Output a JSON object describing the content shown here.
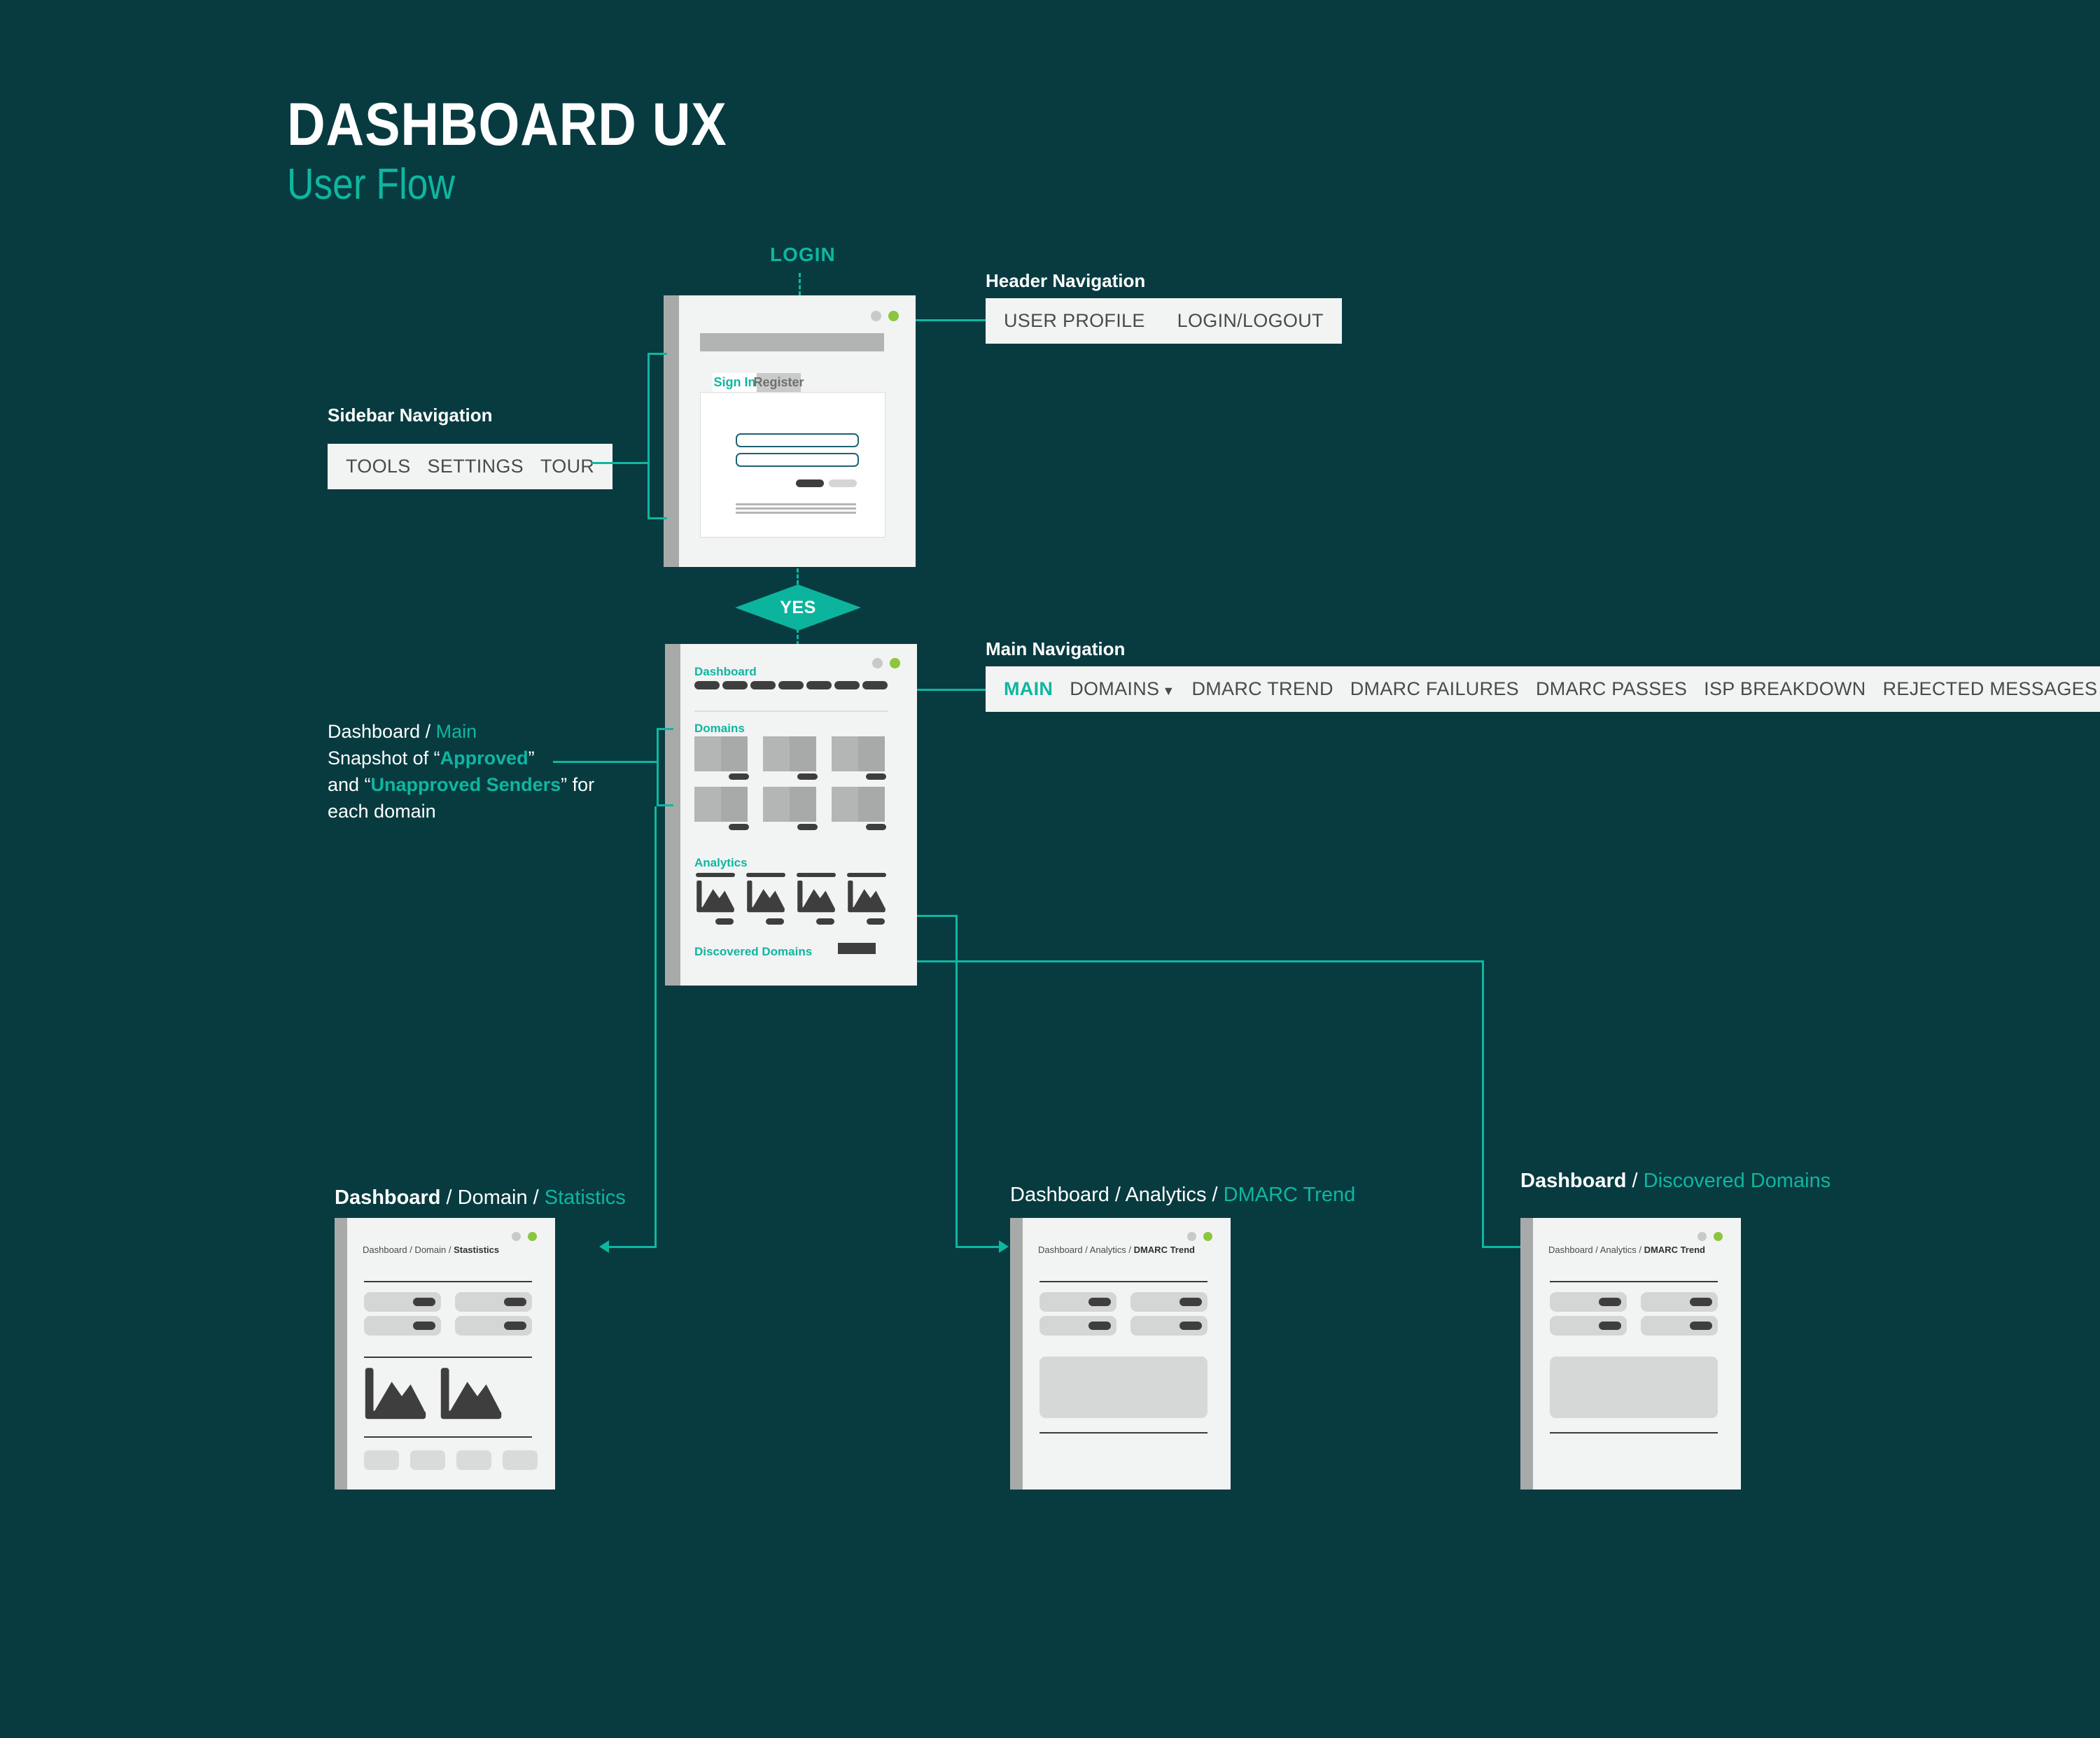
{
  "meta": {
    "bg_color": "#073B40",
    "accent_color": "#0FB6A0",
    "panel_color": "#F2F3F3",
    "dark_element_color": "#3E3E3E"
  },
  "title": {
    "main": "DASHBOARD UX",
    "sub": "User Flow"
  },
  "flow": {
    "login_label": "LOGIN",
    "yes_label": "YES"
  },
  "header_nav": {
    "heading": "Header Navigation",
    "items": [
      "USER PROFILE",
      "LOGIN/LOGOUT"
    ]
  },
  "sidebar_nav": {
    "heading": "Sidebar Navigation",
    "items": [
      "TOOLS",
      "SETTINGS",
      "TOUR"
    ]
  },
  "main_nav": {
    "heading": "Main Navigation",
    "items": [
      {
        "label": "MAIN",
        "active": true
      },
      {
        "label": "DOMAINS",
        "caret": "▼",
        "active": false
      },
      {
        "label": "DMARC TREND",
        "active": false
      },
      {
        "label": "DMARC FAILURES",
        "active": false
      },
      {
        "label": "DMARC PASSES",
        "active": false
      },
      {
        "label": "ISP BREAKDOWN",
        "active": false
      },
      {
        "label": "REJECTED MESSAGES",
        "active": false
      }
    ]
  },
  "dashboard_note": {
    "line1_prefix": "Dashboard / ",
    "line1_teal": "Main",
    "line2_prefix": "Snapshot of “",
    "line2_teal": "Approved",
    "line2_suffix": "”",
    "line3_prefix": "and “",
    "line3_teal": "Unapproved Senders",
    "line3_suffix": "” for",
    "line4": "each domain"
  },
  "login_screen": {
    "tab_signin": "Sign In",
    "tab_register": "Register"
  },
  "dashboard_screen": {
    "title": "Dashboard",
    "section_domains": "Domains",
    "section_analytics": "Analytics",
    "section_discovered": "Discovered Domains",
    "nav_pill_count": 7,
    "domain_card_count": 6,
    "analytics_chart_count": 4
  },
  "screens": [
    {
      "id": "statistics",
      "caption": {
        "bold": "Dashboard",
        "sep1": " / ",
        "mid": "Domain",
        "sep2": " / ",
        "teal": "Statistics"
      },
      "breadcrumb": {
        "prefix": "Dashboard / Domain / ",
        "current": "Stastistics"
      },
      "layout": "stats"
    },
    {
      "id": "dmarc-trend",
      "caption": {
        "bold": "",
        "sep1": "",
        "mid": "Dashboard / Analytics / ",
        "sep2": "",
        "teal": "DMARC Trend"
      },
      "breadcrumb": {
        "prefix": "Dashboard / Analytics / ",
        "current": "DMARC Trend"
      },
      "layout": "block"
    },
    {
      "id": "discovered-domains",
      "caption": {
        "bold": "Dashboard",
        "sep1": " / ",
        "mid": "",
        "sep2": "",
        "teal": "Discovered Domains"
      },
      "breadcrumb": {
        "prefix": "Dashboard / Analytics / ",
        "current": "DMARC Trend"
      },
      "layout": "block"
    }
  ]
}
